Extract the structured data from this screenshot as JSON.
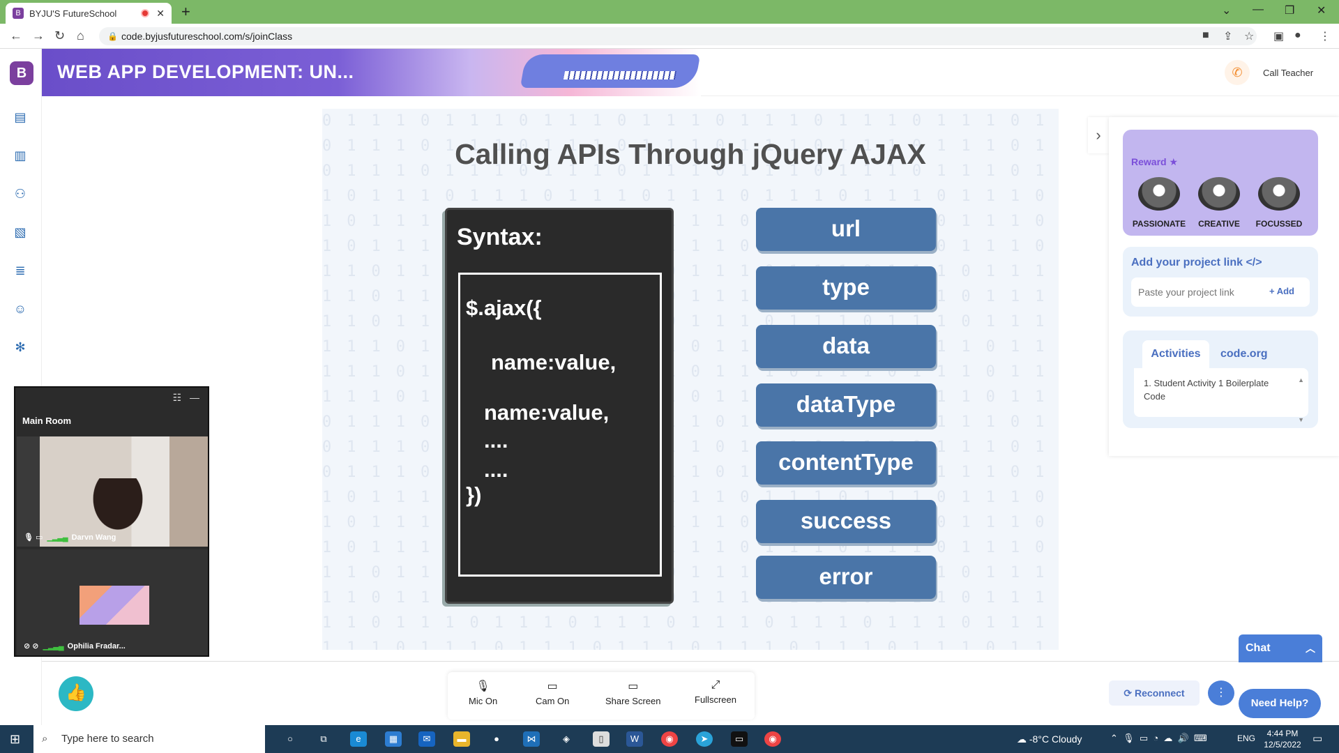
{
  "browser": {
    "tab_title": "BYJU'S FutureSchool",
    "tab_close": "✕",
    "new_tab": "+",
    "url": "code.byjusfutureschool.com/s/joinClass"
  },
  "header": {
    "course_title": "WEB APP DEVELOPMENT: UN...",
    "call_teacher": "Call Teacher"
  },
  "slide": {
    "title": "Calling APIs Through jQuery AJAX",
    "syntax_label": "Syntax:",
    "code_lines": [
      "$.ajax({",
      "name:value,",
      "name:value,",
      "....",
      "....",
      "})"
    ],
    "params": [
      "url",
      "type",
      "data",
      "dataType",
      "contentType",
      "success",
      "error"
    ]
  },
  "right_panel": {
    "reward_label": "Reward ★",
    "badges": [
      "PASSIONATE",
      "CREATIVE",
      "FOCUSSED"
    ],
    "project_title": "Add your project link </>",
    "project_placeholder": "Paste your project link",
    "project_add": "+ Add",
    "tabs": [
      "Activities",
      "code.org"
    ],
    "activity_item": "1.  Student Activity 1 Boilerplate Code"
  },
  "video": {
    "room": "Main Room",
    "participants": [
      "Darvn Wang",
      "Ophilia Fradar..."
    ]
  },
  "controls": {
    "mic": "Mic On",
    "cam": "Cam On",
    "share": "Share Screen",
    "fullscreen": "Fullscreen"
  },
  "chat_label": "Chat",
  "reconnect_label": "Reconnect",
  "help_label": "Need Help?",
  "taskbar": {
    "search_placeholder": "Type here to search",
    "weather": "-8°C  Cloudy",
    "lang": "ENG",
    "time": "4:44 PM",
    "date": "12/5/2022"
  },
  "colors": {
    "tab_strip": "#7cb867",
    "brand_purple": "#7b3f9e",
    "param_blue": "#4a75a8",
    "accent_blue": "#4a7ed8"
  }
}
